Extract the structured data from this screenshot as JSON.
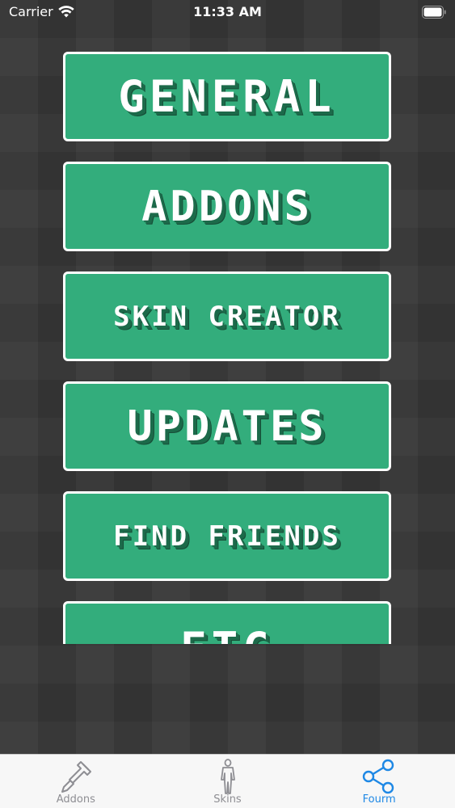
{
  "status_bar": {
    "carrier": "Carrier",
    "time": "11:33 AM"
  },
  "menu": {
    "items": [
      {
        "label": "GENERAL"
      },
      {
        "label": "ADDONS"
      },
      {
        "label": "SKIN CREATOR"
      },
      {
        "label": "UPDATES"
      },
      {
        "label": "FIND FRIENDS"
      },
      {
        "label": "ETC"
      }
    ]
  },
  "tab_bar": {
    "tabs": [
      {
        "label": "Addons",
        "icon": "shovel-icon",
        "active": false
      },
      {
        "label": "Skins",
        "icon": "person-icon",
        "active": false
      },
      {
        "label": "Fourm",
        "icon": "share-icon",
        "active": true
      }
    ]
  },
  "colors": {
    "button_fill": "#33ad7c",
    "button_border": "#ffffff",
    "background": "#363636",
    "tab_active": "#1e88e5",
    "tab_inactive": "#8e8e93"
  }
}
